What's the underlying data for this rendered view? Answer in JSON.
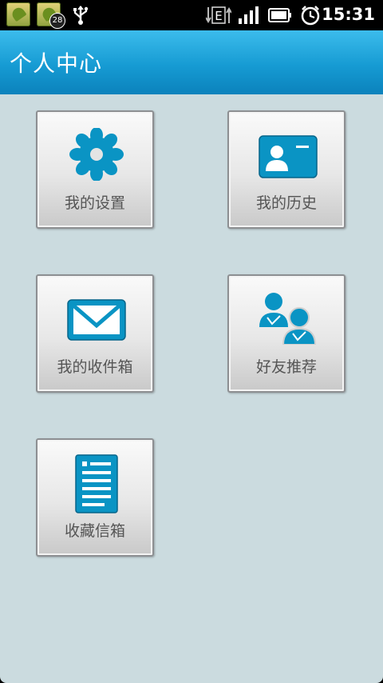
{
  "status_bar": {
    "notification_badge": "28",
    "network_type": "E",
    "time": "15:31",
    "icons": [
      "app-notification-icon",
      "app-notification-icon",
      "usb-icon",
      "data-transfer-icon",
      "signal-icon",
      "battery-icon",
      "alarm-icon"
    ]
  },
  "header": {
    "title": "个人中心"
  },
  "tiles": [
    {
      "label": "我的设置",
      "icon": "gear-icon"
    },
    {
      "label": "我的历史",
      "icon": "id-card-icon"
    },
    {
      "label": "我的收件箱",
      "icon": "envelope-icon"
    },
    {
      "label": "好友推荐",
      "icon": "friends-icon"
    },
    {
      "label": "收藏信箱",
      "icon": "document-icon"
    }
  ],
  "colors": {
    "accent": "#0a94c4",
    "titlebar": "#169bd3",
    "background": "#cbdbdf",
    "label": "#555555"
  }
}
